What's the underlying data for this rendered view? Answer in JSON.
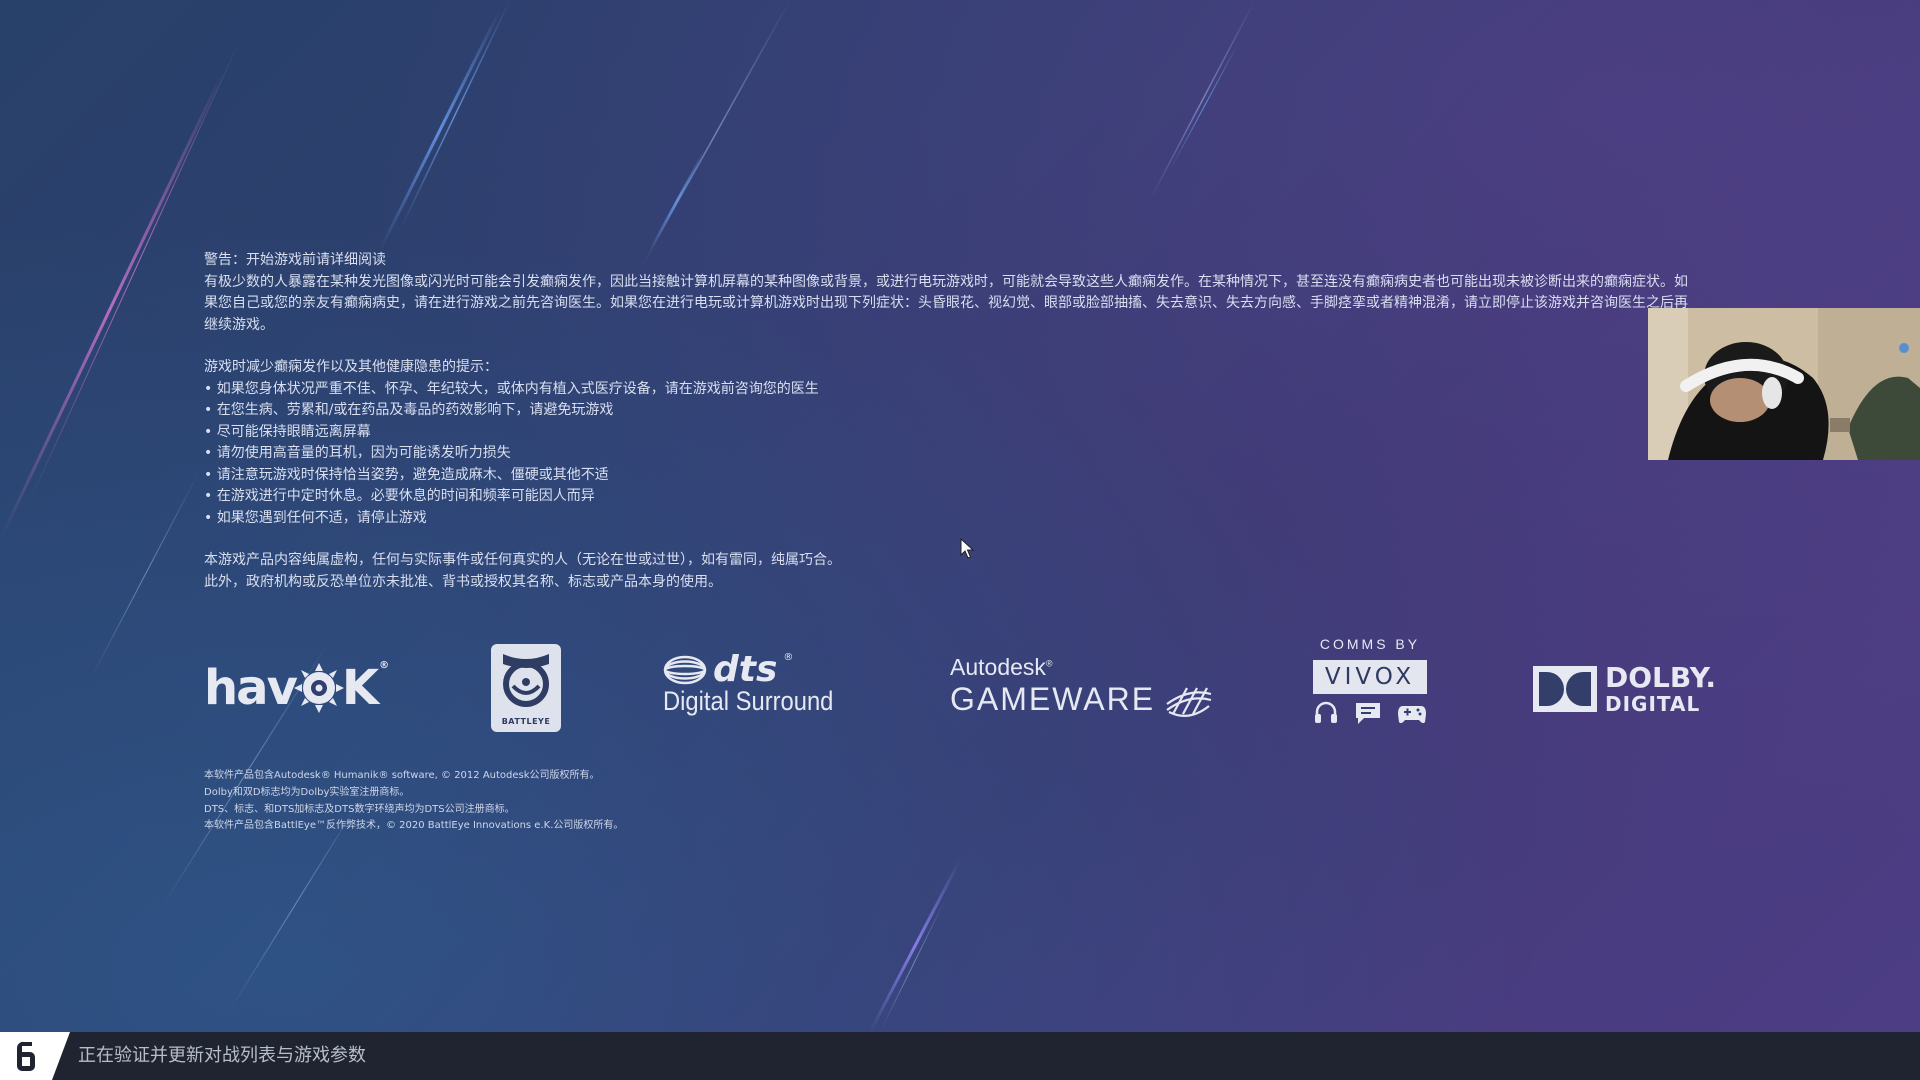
{
  "warning": {
    "title": "警告：开始游戏前请详细阅读",
    "para1": "有极少数的人暴露在某种发光图像或闪光时可能会引发癫痫发作，因此当接触计算机屏幕的某种图像或背景，或进行电玩游戏时，可能就会导致这些人癫痫发作。在某种情况下，甚至连没有癫痫病史者也可能出现未被诊断出来的癫痫症状。如果您自己或您的亲友有癫痫病史，请在进行游戏之前先咨询医生。如果您在进行电玩或计算机游戏时出现下列症状：头昏眼花、视幻觉、眼部或脸部抽搐、失去意识、失去方向感、手脚痉挛或者精神混淆，请立即停止该游戏并咨询医生之后再继续游戏。",
    "tips_title": "游戏时减少癫痫发作以及其他健康隐患的提示：",
    "tips": [
      "如果您身体状况严重不佳、怀孕、年纪较大，或体内有植入式医疗设备，请在游戏前咨询您的医生",
      "在您生病、劳累和/或在药品及毒品的药效影响下，请避免玩游戏",
      "尽可能保持眼睛远离屏幕",
      "请勿使用高音量的耳机，因为可能诱发听力损失",
      "请注意玩游戏时保持恰当姿势，避免造成麻木、僵硬或其他不适",
      "在游戏进行中定时休息。必要休息的时间和频率可能因人而异",
      "如果您遇到任何不适，请停止游戏"
    ],
    "fiction1": "本游戏产品内容纯属虚构，任何与实际事件或任何真实的人（无论在世或过世），如有雷同，纯属巧合。",
    "fiction2": "此外，政府机构或反恐单位亦未批准、背书或授权其名称、标志或产品本身的使用。"
  },
  "logos": {
    "havok": {
      "pre": "hav",
      "post": "K",
      "tm": "®"
    },
    "battleye": {
      "label": "BATTLEYE"
    },
    "dts": {
      "word": "dts",
      "sub": "Digital Surround",
      "reg": "®"
    },
    "gameware": {
      "brand": "Autodesk",
      "product": "GAMEWARE",
      "reg": "®"
    },
    "vivox": {
      "comms": "COMMS BY",
      "name": "VIVOX"
    },
    "dolby": {
      "line1": "DOLBY",
      "line2": "DIGITAL",
      "tm": "."
    }
  },
  "legal": [
    "本软件产品包含Autodesk® Humanik® software, © 2012 Autodesk公司版权所有。",
    "Dolby和双D标志均为Dolby实验室注册商标。",
    "DTS、标志、和DTS加标志及DTS数字环绕声均为DTS公司注册商标。",
    "本软件产品包含BattlEye™反作弊技术，© 2020 BattlEye Innovations e.K.公司版权所有。"
  ],
  "status": {
    "text": "正在验证并更新对战列表与游戏参数"
  },
  "colors": {
    "bg_top": "#303f70",
    "bg_bottom_left": "#28416a",
    "bg_top_right": "#4c3d86",
    "statusbar": "#1f2430",
    "text": "#d9dff0"
  }
}
